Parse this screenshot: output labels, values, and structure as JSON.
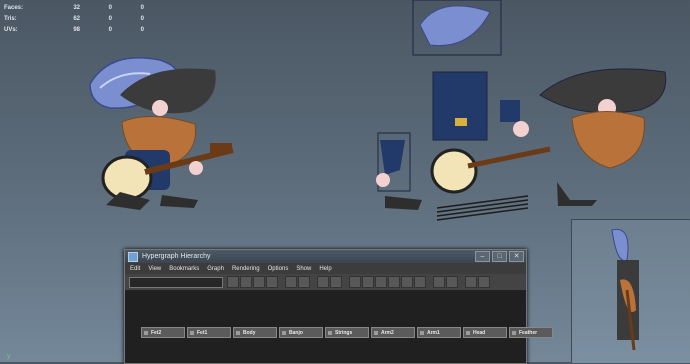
{
  "stats": {
    "rows": [
      {
        "label": "Faces:",
        "v1": "32",
        "v2": "0",
        "v3": "0"
      },
      {
        "label": "Tris:",
        "v1": "62",
        "v2": "0",
        "v3": "0"
      },
      {
        "label": "UVs:",
        "v1": "98",
        "v2": "0",
        "v3": "0"
      }
    ]
  },
  "axis": {
    "label": "y"
  },
  "hypergraph": {
    "title": "Hypergraph Hierarchy",
    "menu": [
      "Edit",
      "View",
      "Bookmarks",
      "Graph",
      "Rendering",
      "Options",
      "Show",
      "Help"
    ],
    "nodes": [
      "Fet2",
      "Fet1",
      "Body",
      "Banjo",
      "Strings",
      "Arm2",
      "Arm1",
      "Head",
      "Feather"
    ]
  },
  "colors": {
    "accent": "#6fa2d6",
    "feather": "#7b8fd0",
    "beard": "#b9733a",
    "hat": "#3b3b3b",
    "coat": "#223a6a"
  }
}
